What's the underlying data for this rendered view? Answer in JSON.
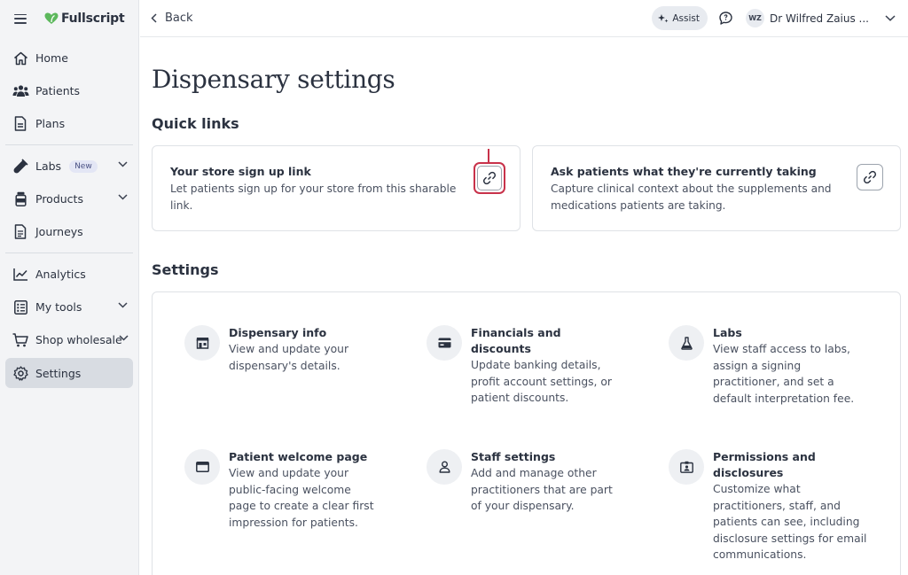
{
  "brand": {
    "name": "Fullscript"
  },
  "sidebar": {
    "items": [
      {
        "label": "Home",
        "icon": "home-icon"
      },
      {
        "label": "Patients",
        "icon": "patients-icon"
      },
      {
        "label": "Plans",
        "icon": "document-icon"
      },
      {
        "label": "Labs",
        "icon": "test-tube-icon",
        "badge": "New"
      },
      {
        "label": "Products",
        "icon": "bottle-icon"
      },
      {
        "label": "Journeys",
        "icon": "journey-icon"
      },
      {
        "label": "Analytics",
        "icon": "chart-icon"
      },
      {
        "label": "My tools",
        "icon": "checklist-icon"
      },
      {
        "label": "Shop wholesale",
        "icon": "cart-icon"
      },
      {
        "label": "Settings",
        "icon": "gear-icon",
        "active": true
      }
    ]
  },
  "topbar": {
    "back_label": "Back",
    "assist_label": "Assist",
    "user_initials": "WZ",
    "user_name": "Dr Wilfred Zaius ..."
  },
  "page": {
    "title": "Dispensary settings",
    "quick_links_title": "Quick links",
    "quick_links": [
      {
        "title": "Your store sign up link",
        "description": "Let patients sign up for your store from this sharable link."
      },
      {
        "title": "Ask patients what they're currently taking",
        "description": "Capture clinical context about the supplements and medications patients are taking."
      }
    ],
    "settings_title": "Settings",
    "settings": [
      {
        "title": "Dispensary info",
        "description": "View and update your dispensary's details.",
        "icon": "storefront-icon"
      },
      {
        "title": "Financials and discounts",
        "description": "Update banking details, profit account settings, or patient discounts.",
        "icon": "credit-card-icon"
      },
      {
        "title": "Labs",
        "description": "View staff access to labs, assign a signing practitioner, and set a default interpretation fee.",
        "icon": "flask-icon"
      },
      {
        "title": "Patient welcome page",
        "description": "View and update your public-facing welcome page to create a clear first impression for patients.",
        "icon": "browser-window-icon"
      },
      {
        "title": "Staff settings",
        "description": "Add and manage other practitioners that are part of your dispensary.",
        "icon": "person-icon"
      },
      {
        "title": "Permissions and disclosures",
        "description": "Customize what practitioners, staff, and patients can see, including disclosure settings for email communications.",
        "icon": "id-badge-icon"
      }
    ]
  },
  "colors": {
    "highlight": "#c8324a",
    "brand_green": "#5cb85c",
    "sidebar_bg": "#f3f4f6",
    "active_bg": "#d8dce2"
  }
}
